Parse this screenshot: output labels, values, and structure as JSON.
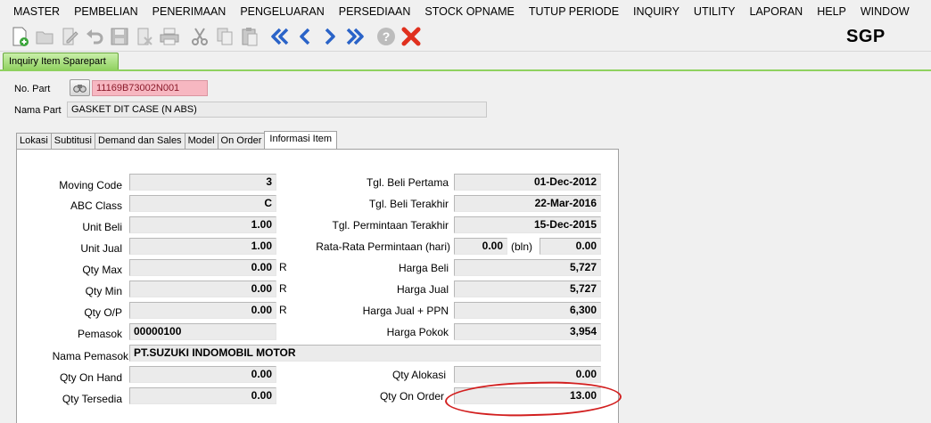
{
  "menu": [
    "MASTER",
    "PEMBELIAN",
    "PENERIMAAN",
    "PENGELUARAN",
    "PERSEDIAAN",
    "STOCK OPNAME",
    "TUTUP PERIODE",
    "INQUIRY",
    "UTILITY",
    "LAPORAN",
    "HELP",
    "WINDOW"
  ],
  "toolbar": {
    "brand": "SGP",
    "icons": [
      "new-icon",
      "open-icon",
      "edit-icon",
      "undo-icon",
      "save-icon",
      "delete-icon",
      "print-icon",
      "cut-icon",
      "copy-icon",
      "paste-icon",
      "first-record-icon",
      "previous-record-icon",
      "next-record-icon",
      "last-record-icon",
      "help-icon",
      "close-icon"
    ]
  },
  "doc_tab": "Inquiry Item Sparepart",
  "header": {
    "part_no_label": "No. Part",
    "part_no_value": "11169B73002N001",
    "part_name_label": "Nama Part",
    "part_name_value": "GASKET DIT CASE (N ABS)"
  },
  "tabs": [
    {
      "label": "Lokasi",
      "active": false
    },
    {
      "label": "Subtitusi",
      "active": false
    },
    {
      "label": "Demand dan Sales",
      "active": false
    },
    {
      "label": "Model",
      "active": false
    },
    {
      "label": "On Order",
      "active": false
    },
    {
      "label": "Informasi Item",
      "active": true
    }
  ],
  "info": {
    "moving_code": {
      "label": "Moving Code",
      "value": "3"
    },
    "abc_class": {
      "label": "ABC Class",
      "value": "C"
    },
    "unit_beli": {
      "label": "Unit Beli",
      "value": "1.00"
    },
    "unit_jual": {
      "label": "Unit Jual",
      "value": "1.00"
    },
    "qty_max": {
      "label": "Qty Max",
      "value": "0.00",
      "unit": "R"
    },
    "qty_min": {
      "label": "Qty Min",
      "value": "0.00",
      "unit": "R"
    },
    "qty_op": {
      "label": "Qty O/P",
      "value": "0.00",
      "unit": "R"
    },
    "pemasok": {
      "label": "Pemasok",
      "value": "00000100"
    },
    "nama_pemasok": {
      "label": "Nama Pemasok",
      "value": "PT.SUZUKI INDOMOBIL MOTOR"
    },
    "qty_on_hand": {
      "label": "Qty On Hand",
      "value": "0.00"
    },
    "qty_tersedia": {
      "label": "Qty Tersedia",
      "value": "0.00"
    },
    "tgl_beli_pertama": {
      "label": "Tgl. Beli Pertama",
      "value": "01-Dec-2012"
    },
    "tgl_beli_terakhir": {
      "label": "Tgl. Beli Terakhir",
      "value": "22-Mar-2016"
    },
    "tgl_permintaan_terakhir": {
      "label": "Tgl. Permintaan Terakhir",
      "value": "15-Dec-2015"
    },
    "rata_rata": {
      "label": "Rata-Rata Permintaan (hari)",
      "value_hari": "0.00",
      "unit_bln": "(bln)",
      "value_bln": "0.00"
    },
    "harga_beli": {
      "label": "Harga Beli",
      "value": "5,727"
    },
    "harga_jual": {
      "label": "Harga Jual",
      "value": "5,727"
    },
    "harga_jual_ppn": {
      "label": "Harga Jual + PPN",
      "value": "6,300"
    },
    "harga_pokok": {
      "label": "Harga Pokok",
      "value": "3,954"
    },
    "qty_alokasi": {
      "label": "Qty Alokasi",
      "value": "0.00"
    },
    "qty_on_order": {
      "label": "Qty On Order",
      "value": "13.00"
    }
  },
  "annotation_color": "#d21f1f"
}
